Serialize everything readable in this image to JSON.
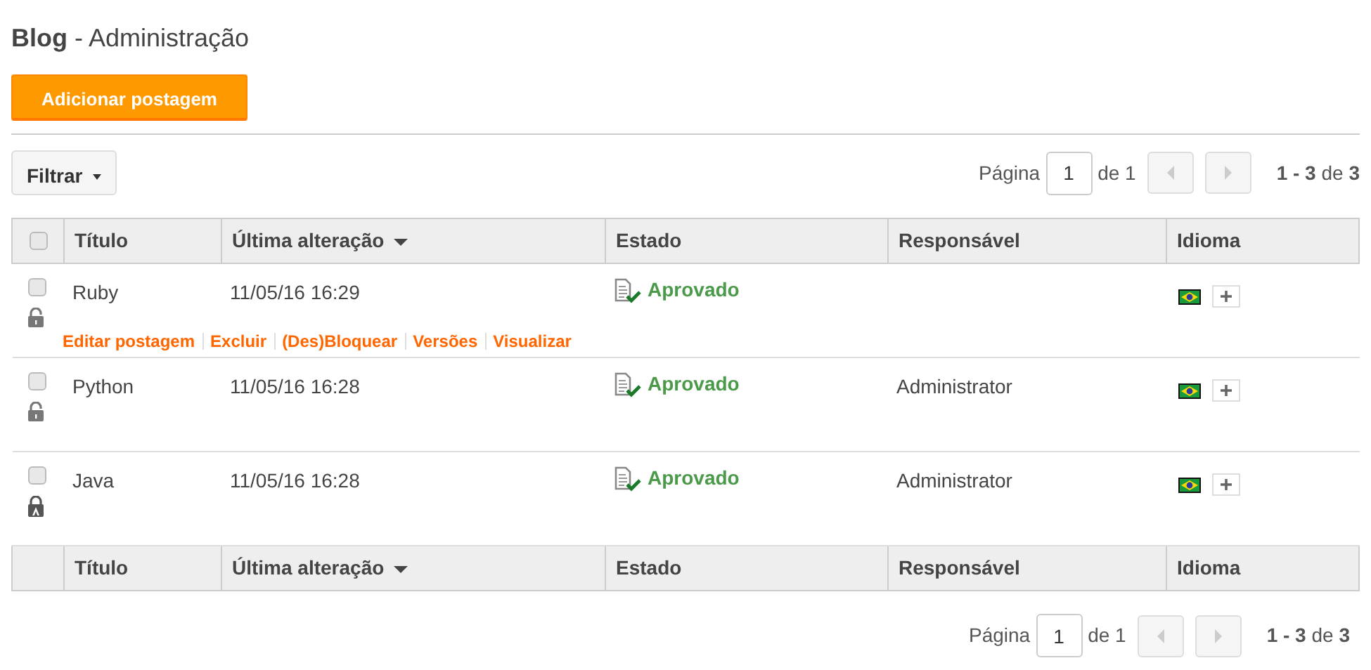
{
  "title": {
    "app": "Blog",
    "section": "- Administração"
  },
  "add_button": "Adicionar postagem",
  "filter_button": "Filtrar",
  "pagination_top": {
    "label": "Página",
    "page": "1",
    "of": "de 1",
    "range": "**1 - 3** de **3**"
  },
  "table": {
    "select_all": {
      "checked": false
    },
    "columns": [
      {
        "label": "Título",
        "sorted": false
      },
      {
        "label": "Última alteração",
        "sorted": true
      },
      {
        "label": "Estado",
        "sorted": false
      },
      {
        "label": "Responsável",
        "sorted": false
      },
      {
        "label": "Idioma",
        "sorted": false
      }
    ],
    "rows": [
      {
        "checked": false,
        "locked": false,
        "title": "Ruby",
        "modified": "11/05/16 16:29",
        "status": "Aprovado",
        "actions": [
          "Editar postagem",
          "Excluir",
          "(Des)Bloquear",
          "Versões",
          "Visualizar"
        ]
      },
      {
        "checked": false,
        "locked": false,
        "title": "Python",
        "modified": "11/05/16 16:28",
        "status": "Aprovado",
        "owner": "Administrator"
      },
      {
        "checked": false,
        "locked": true,
        "title": "Java",
        "modified": "11/05/16 16:28",
        "status": "Aprovado",
        "owner": "Administrator"
      }
    ],
    "footer_columns": [
      "Título",
      "Última alteração",
      "Estado",
      "Responsável",
      "Idioma"
    ]
  },
  "pagination_bottom": {
    "label": "Página",
    "page": "1",
    "of": "de 1",
    "range": "**1 - 3** de **3**"
  }
}
